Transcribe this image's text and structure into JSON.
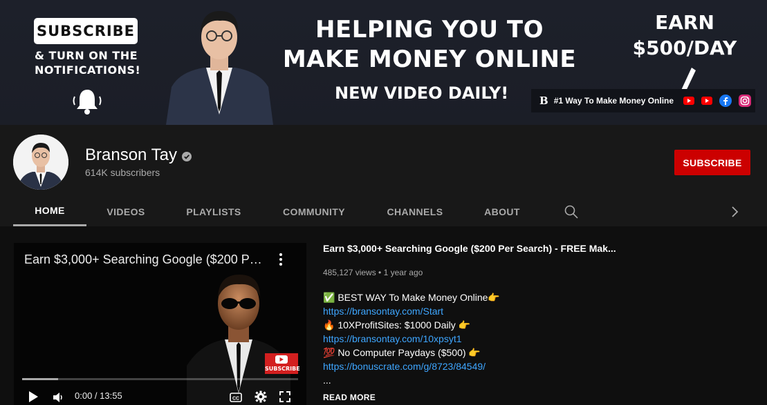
{
  "banner": {
    "subscribe_box": "SUBSCRIBE",
    "turn_on_line1": "& TURN ON THE",
    "turn_on_line2": "NOTIFICATIONS!",
    "headline_line1": "HELPING YOU TO",
    "headline_line2": "MAKE MONEY ONLINE",
    "daily": "NEW VIDEO DAILY!",
    "earn_line1": "EARN",
    "earn_line2": "$500/DAY",
    "strip_logo": "B",
    "strip_slogan": "#1 Way To Make Money Online",
    "strip_icons": [
      "youtube-icon",
      "youtube-icon",
      "facebook-icon",
      "instagram-icon"
    ]
  },
  "channel": {
    "name": "Branson Tay",
    "subscribers": "614K subscribers",
    "subscribe_button": "SUBSCRIBE"
  },
  "tabs": [
    {
      "label": "HOME",
      "active": true
    },
    {
      "label": "VIDEOS",
      "active": false
    },
    {
      "label": "PLAYLISTS",
      "active": false
    },
    {
      "label": "COMMUNITY",
      "active": false
    },
    {
      "label": "CHANNELS",
      "active": false
    },
    {
      "label": "ABOUT",
      "active": false
    }
  ],
  "player": {
    "title": "Earn $3,000+ Searching Google ($200 Per...",
    "time": "0:00 / 13:55",
    "progress_fraction": 0.13,
    "badge_text": "SUBSCRIBE"
  },
  "video": {
    "title": "Earn $3,000+ Searching Google ($200 Per Search) - FREE Mak...",
    "meta": "485,127 views • 1 year ago",
    "desc": [
      {
        "text": "✅ BEST WAY To Make Money Online👉",
        "link": false
      },
      {
        "text": "https://bransontay.com/Start",
        "link": true
      },
      {
        "text": "🔥 10XProfitSites: $1000 Daily 👉",
        "link": false
      },
      {
        "text": "https://bransontay.com/10xpsyt1",
        "link": true
      },
      {
        "text": "💯 No Computer Paydays ($500) 👉",
        "link": false
      },
      {
        "text": "https://bonuscrate.com/g/8723/84549/",
        "link": true
      },
      {
        "text": "...",
        "link": false
      }
    ],
    "read_more": "READ MORE"
  },
  "colors": {
    "subscribe_red": "#cc0000",
    "link_blue": "#3ea6ff",
    "header_bg": "#181818",
    "page_bg": "#0f0f0f"
  }
}
